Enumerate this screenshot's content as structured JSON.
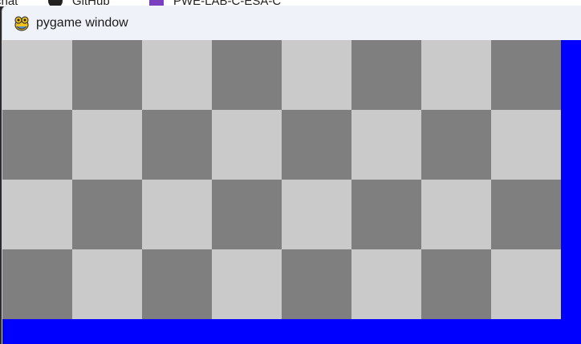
{
  "background_taskbar": {
    "items": [
      {
        "label": "chat"
      },
      {
        "label": "GitHub",
        "icon": "github-icon"
      },
      {
        "label": "PWE-LAB-C-ESA-C",
        "icon": "app-tile-icon"
      }
    ]
  },
  "window": {
    "title": "pygame window",
    "icon": "pygame-snake-icon"
  },
  "game": {
    "background_color": "#0000ff",
    "board": {
      "rows": 4,
      "cols": 8,
      "light_color": "#cacaca",
      "dark_color": "#7f7f7f",
      "top_left": "light"
    }
  }
}
